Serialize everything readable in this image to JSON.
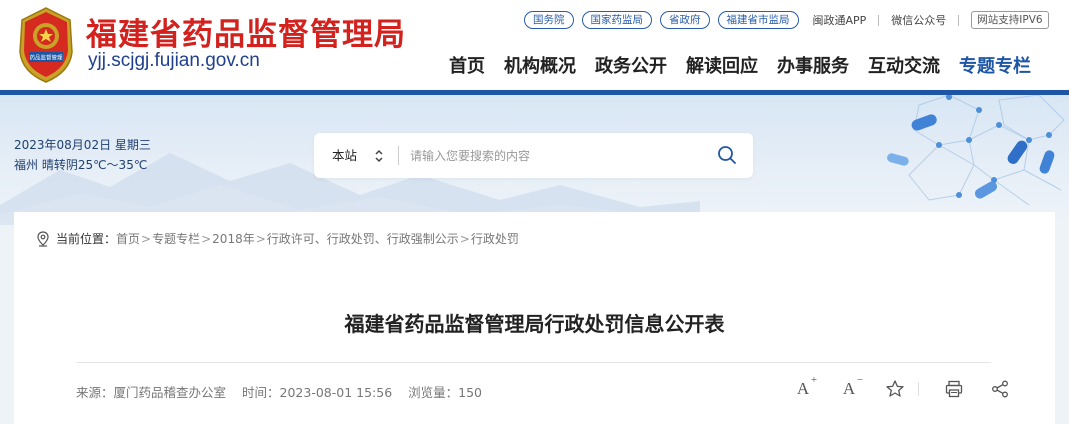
{
  "header": {
    "title": "福建省药品监督管理局",
    "domain": "yjj.scjgj.fujian.gov.cn",
    "top_links": [
      "国务院",
      "国家药监局",
      "省政府",
      "福建省市监局"
    ],
    "app_link": "闽政通APP",
    "wechat_link": "微信公众号",
    "ipv6_badge": "网站支持IPV6",
    "emblem_text": "药品监督管理",
    "nav": [
      "首页",
      "机构概况",
      "政务公开",
      "解读回应",
      "办事服务",
      "互动交流",
      "专题专栏"
    ],
    "nav_active": "专题专栏"
  },
  "banner": {
    "date": "2023年08月02日  星期三",
    "weather": "福州  晴转阴25℃～35℃",
    "search": {
      "scope": "本站",
      "placeholder": "请输入您要搜索的内容"
    }
  },
  "breadcrumb": {
    "lead": "当前位置：",
    "items": [
      "首页",
      "专题专栏",
      "2018年",
      "行政许可、行政处罚、行政强制公示",
      "行政处罚"
    ],
    "separator": ">"
  },
  "article": {
    "title": "福建省药品监督管理局行政处罚信息公开表",
    "source": "来源：厦门药品稽查办公室",
    "time": "时间：2023-08-01 15:56",
    "views": "浏览量：150"
  },
  "tools": [
    "font-increase-icon",
    "font-decrease-icon",
    "star-icon",
    "print-icon",
    "share-icon"
  ],
  "colors": {
    "title_red": "#d3211d",
    "brand_blue": "#1e56a6",
    "domain_blue": "#1f3f8f"
  }
}
